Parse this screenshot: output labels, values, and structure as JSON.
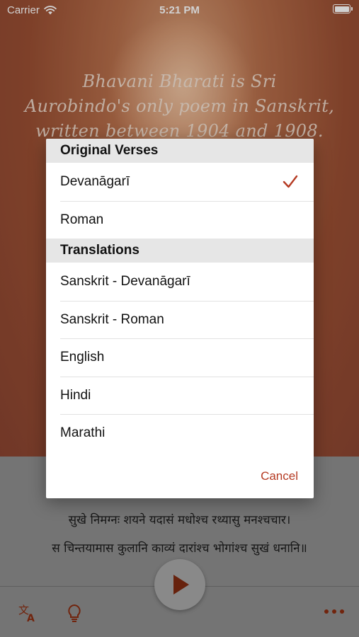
{
  "status_bar": {
    "carrier": "Carrier",
    "time": "5:21 PM"
  },
  "hero": {
    "lines": [
      "Bhavani Bharati is Sri",
      "Aurobindo's only poem in Sanskrit,",
      "written between 1904 and 1908."
    ]
  },
  "verse": {
    "line1": "सुखे निमग्नः शयने यदासं मधोश्च रथ्यासु मनश्चचार।",
    "line2": "स चिन्तयामास कुलानि काव्यं दारांश्च भोगांश्च सुखं धनानि॥"
  },
  "menu": {
    "sections": [
      {
        "title": "Original Verses",
        "items": [
          "Devanāgarī",
          "Roman"
        ]
      },
      {
        "title": "Translations",
        "items": [
          "Sanskrit - Devanāgarī",
          "Sanskrit - Roman",
          "English",
          "Hindi",
          "Marathi"
        ]
      }
    ],
    "selected": "Devanāgarī",
    "cancel_label": "Cancel"
  },
  "toolbar": {
    "icons": [
      "translate-icon",
      "lightbulb-icon",
      "play-icon",
      "more-icon"
    ]
  },
  "colors": {
    "accent": "#b53a22",
    "icon": "#8a2c10"
  }
}
